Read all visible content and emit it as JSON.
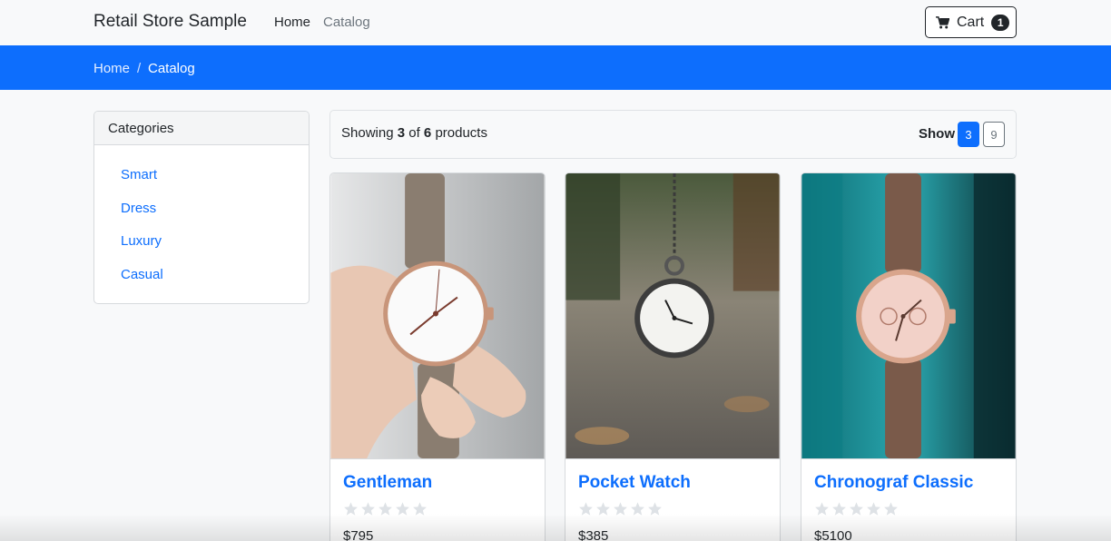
{
  "navbar": {
    "brand": "Retail Store Sample",
    "links": [
      "Home",
      "Catalog"
    ],
    "cart_label": "Cart",
    "cart_count": "1"
  },
  "breadcrumb": {
    "home": "Home",
    "separator": "/",
    "current": "Catalog"
  },
  "categories": {
    "title": "Categories",
    "items": [
      "Smart",
      "Dress",
      "Luxury",
      "Casual"
    ]
  },
  "summary": {
    "prefix": "Showing",
    "shown": "3",
    "of": "of",
    "total": "6",
    "suffix": "products",
    "show_label": "Show",
    "page_sizes": [
      "3",
      "9"
    ],
    "selected_page_size": "3"
  },
  "products": [
    {
      "name": "Gentleman",
      "price": "$795",
      "rating": 0
    },
    {
      "name": "Pocket Watch",
      "price": "$385",
      "rating": 0
    },
    {
      "name": "Chronograf Classic",
      "price": "$5100",
      "rating": 0
    }
  ],
  "colors": {
    "primary": "#0d6efd",
    "text": "#212529",
    "muted": "#6c757d",
    "star_empty": "#dee2e6"
  }
}
